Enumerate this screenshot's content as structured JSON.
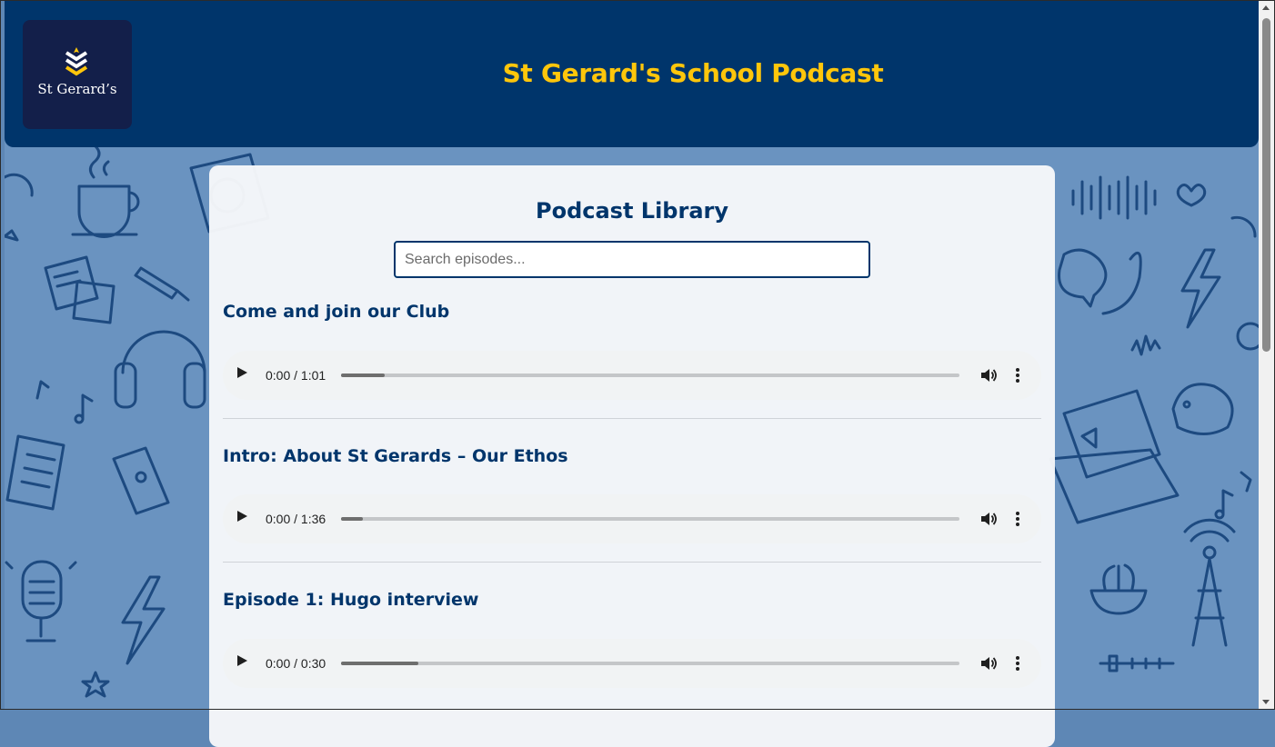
{
  "header": {
    "logo_text": "St Gerard’s",
    "title": "St Gerard's School Podcast"
  },
  "library": {
    "title": "Podcast Library",
    "search_placeholder": "Search episodes..."
  },
  "episodes": [
    {
      "title": "Come and join our Club",
      "time": "0:00 / 1:01",
      "buffered_fraction": 0.07
    },
    {
      "title": "Intro: About St Gerards – Our Ethos",
      "time": "0:00 / 1:36",
      "buffered_fraction": 0.035
    },
    {
      "title": "Episode 1: Hugo interview",
      "time": "0:00 / 0:30",
      "buffered_fraction": 0.125
    }
  ],
  "colors": {
    "header_bg": "#00356b",
    "title_gold": "#ffc60b",
    "logo_bg": "#131f4a",
    "page_bg": "#6a93c0",
    "panel_bg": "#f7f8fa",
    "doodle_stroke": "#1d4a80"
  },
  "icons": {
    "crest": "chevron-shield-icon",
    "play": "play-icon",
    "volume": "volume-icon",
    "more": "more-vertical-icon"
  }
}
